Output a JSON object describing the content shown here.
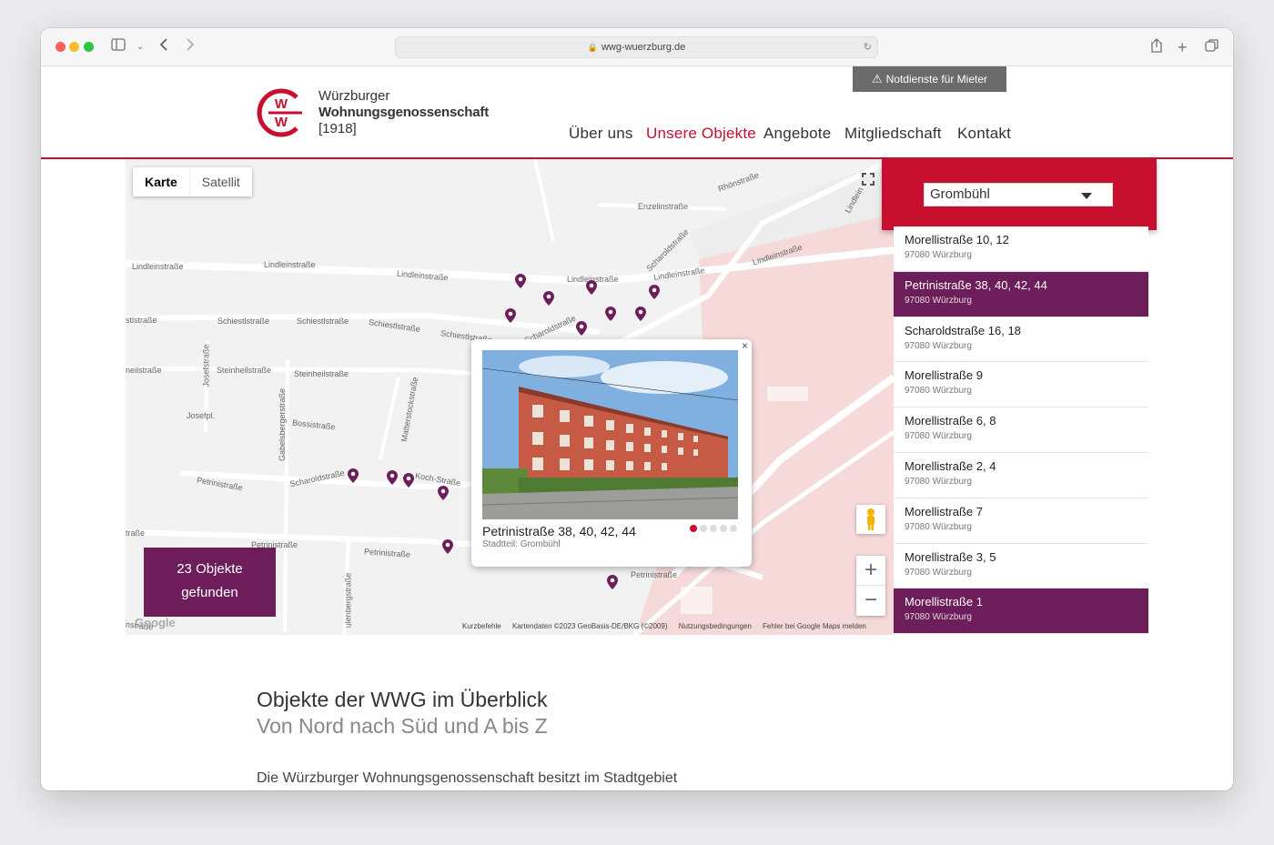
{
  "browser": {
    "url": "wwg-wuerzburg.de",
    "traffic_colors": [
      "#fe5f57",
      "#febc2e",
      "#28c840"
    ]
  },
  "header": {
    "notdienst": "Notdienste für Mieter",
    "brand_line1": "Würzburger",
    "brand_line2": "Wohnungsgenossenschaft",
    "brand_line3": "[1918]",
    "logo_letters": "WW",
    "nav": [
      "Über uns",
      "Unsere Objekte",
      "Angebote",
      "Mitgliedschaft",
      "Kontakt"
    ],
    "active_nav": "Unsere Objekte",
    "accent_color": "#c8102e"
  },
  "map": {
    "type_map": "Karte",
    "type_satellite": "Satellit",
    "streets": [
      "Lindleinstraße",
      "Lindleinstraße",
      "Lindleinstraße",
      "Lindleinstraße",
      "Lindleinstraße",
      "Lindleinstraße",
      "Enzelinstraße",
      "Rhönstraße",
      "Scharoldstraße",
      "Scharoldstraße",
      "Scharoldstraße",
      "Schiestlstraße",
      "Schiestlstraße",
      "Schiestlstraße",
      "Schiestlstraße",
      "Steinheilstraße",
      "Steinheilstraße",
      "Josefstraße",
      "Josefpl.",
      "Gabelsbergerstraße",
      "Bossistraße",
      "Matterstockstraße",
      "Petrinistraße",
      "Petrinistraße",
      "Petrinistraße",
      "Koch-Straße",
      "stlstraße",
      "neilstraße",
      "traße",
      "Lindlein",
      "ulenbergstraße",
      "nstraße"
    ],
    "popup": {
      "title": "Petrinistraße 38, 40, 42, 44",
      "subtitle": "Stadtteil: Grombühl",
      "close": "×"
    },
    "found_count": "23 Objekte",
    "found_label": "gefunden",
    "zoom_in": "+",
    "zoom_out": "−",
    "google": "Google",
    "attribution": [
      "Kurzbefehle",
      "Kartendaten ©2023 GeoBasis-DE/BKG (©2009)",
      "Nutzungsbedingungen",
      "Fehler bei Google Maps melden"
    ],
    "pin_color": "#6c1d5a"
  },
  "district": {
    "selected": "Grombühl"
  },
  "properties": [
    {
      "title": "Morellistraße 10, 12",
      "sub": "97080 Würzburg",
      "highlighted": false
    },
    {
      "title": "Petrinistraße 38, 40, 42, 44",
      "sub": "97080 Würzburg",
      "highlighted": true
    },
    {
      "title": "Scharoldstraße 16, 18",
      "sub": "97080 Würzburg",
      "highlighted": false
    },
    {
      "title": "Morellistraße 9",
      "sub": "97080 Würzburg",
      "highlighted": false
    },
    {
      "title": "Morellistraße 6, 8",
      "sub": "97080 Würzburg",
      "highlighted": false
    },
    {
      "title": "Morellistraße 2, 4",
      "sub": "97080 Würzburg",
      "highlighted": false
    },
    {
      "title": "Morellistraße 7",
      "sub": "97080 Würzburg",
      "highlighted": false
    },
    {
      "title": "Morellistraße 3, 5",
      "sub": "97080 Würzburg",
      "highlighted": false
    },
    {
      "title": "Morellistraße 1",
      "sub": "97080 Würzburg",
      "highlighted": true
    }
  ],
  "content": {
    "heading": "Objekte der WWG im Überblick",
    "subheading": "Von Nord nach Süd und A bis Z",
    "intro": "Die Würzburger Wohnungsgenossenschaft besitzt im Stadtgebiet"
  }
}
